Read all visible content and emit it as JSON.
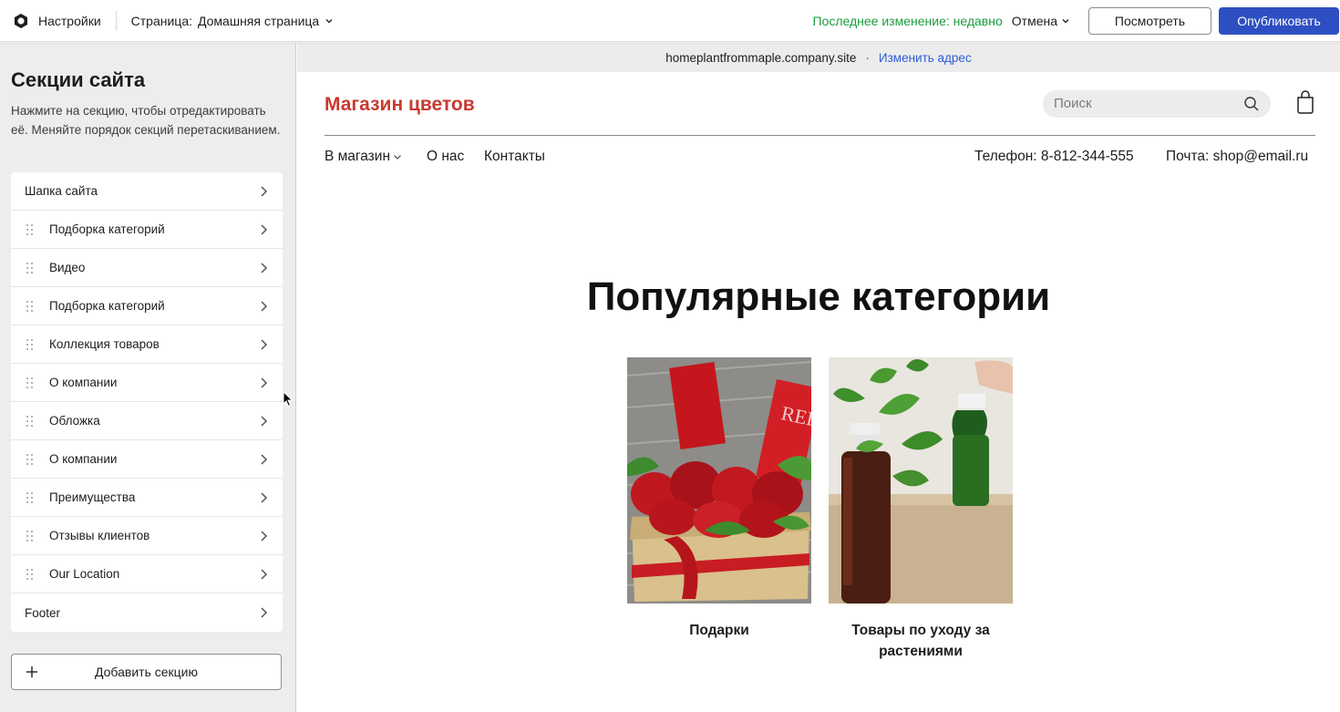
{
  "topbar": {
    "settings_label": "Настройки",
    "page_label": "Страница:",
    "page_value": "Домашняя страница",
    "last_change": "Последнее изменение: недавно",
    "cancel_label": "Отмена",
    "preview_label": "Посмотреть",
    "publish_label": "Опубликовать"
  },
  "sidebar": {
    "title": "Секции сайта",
    "description": "Нажмите на секцию, чтобы отредактировать её. Меняйте порядок секций перетаскиванием.",
    "sections": [
      {
        "label": "Шапка сайта",
        "draggable": false
      },
      {
        "label": "Подборка категорий",
        "draggable": true
      },
      {
        "label": "Видео",
        "draggable": true
      },
      {
        "label": "Подборка категорий",
        "draggable": true
      },
      {
        "label": "Коллекция товаров",
        "draggable": true
      },
      {
        "label": "О компании",
        "draggable": true
      },
      {
        "label": "Обложка",
        "draggable": true
      },
      {
        "label": "О компании",
        "draggable": true
      },
      {
        "label": "Преимущества",
        "draggable": true
      },
      {
        "label": "Отзывы клиентов",
        "draggable": true
      },
      {
        "label": "Our Location",
        "draggable": true
      },
      {
        "label": "Footer",
        "draggable": false
      }
    ],
    "add_section_label": "Добавить секцию"
  },
  "preview": {
    "address": "homeplantfrommaple.company.site",
    "address_separator": "·",
    "change_address_label": "Изменить адрес",
    "store_name": "Магазин цветов",
    "search_placeholder": "Поиск",
    "nav": {
      "shop": "В магазин",
      "about": "О нас",
      "contacts": "Контакты",
      "phone": "Телефон: 8-812-344-555",
      "email": "Почта: shop@email.ru"
    },
    "heading": "Популярные категории",
    "categories": [
      {
        "title": "Подарки"
      },
      {
        "title": "Товары по уходу за растениями"
      }
    ]
  },
  "colors": {
    "accent": "#2d4fc2",
    "store_name": "#c8392f",
    "status_green": "#1a9c3e",
    "link": "#2d5bd6"
  }
}
